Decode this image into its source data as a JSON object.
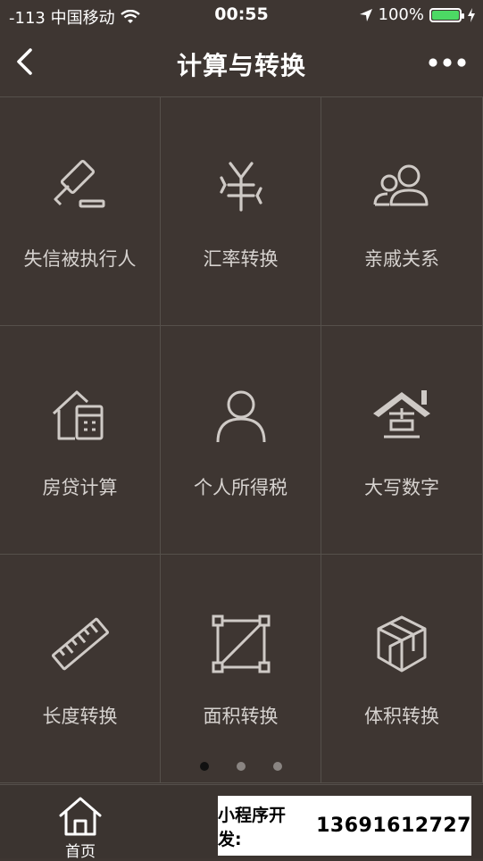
{
  "status_bar": {
    "carrier": "-113 中国移动",
    "time": "00:55",
    "battery": "100%",
    "battery_color": "#4cd964"
  },
  "navbar": {
    "title": "计算与转换",
    "back_icon": "chevron-left-icon",
    "more_icon": "more-dots-icon"
  },
  "grid": {
    "items": [
      {
        "label": "失信被执行人",
        "icon": "gavel-icon"
      },
      {
        "label": "汇率转换",
        "icon": "yuan-exchange-icon"
      },
      {
        "label": "亲戚关系",
        "icon": "people-icon"
      },
      {
        "label": "房贷计算",
        "icon": "house-calculator-icon"
      },
      {
        "label": "个人所得税",
        "icon": "person-icon"
      },
      {
        "label": "大写数字",
        "icon": "house-number-icon"
      },
      {
        "label": "长度转换",
        "icon": "ruler-icon"
      },
      {
        "label": "面积转换",
        "icon": "area-square-icon"
      },
      {
        "label": "体积转换",
        "icon": "cube-icon"
      }
    ]
  },
  "pager": {
    "count": 3,
    "active": 0,
    "active_color": "#111111",
    "inactive_color": "#8a8582"
  },
  "tabbar": {
    "home_label": "首页",
    "home_icon": "home-icon"
  },
  "promo": {
    "prefix": "小程序开发:",
    "phone": "13691612727"
  }
}
